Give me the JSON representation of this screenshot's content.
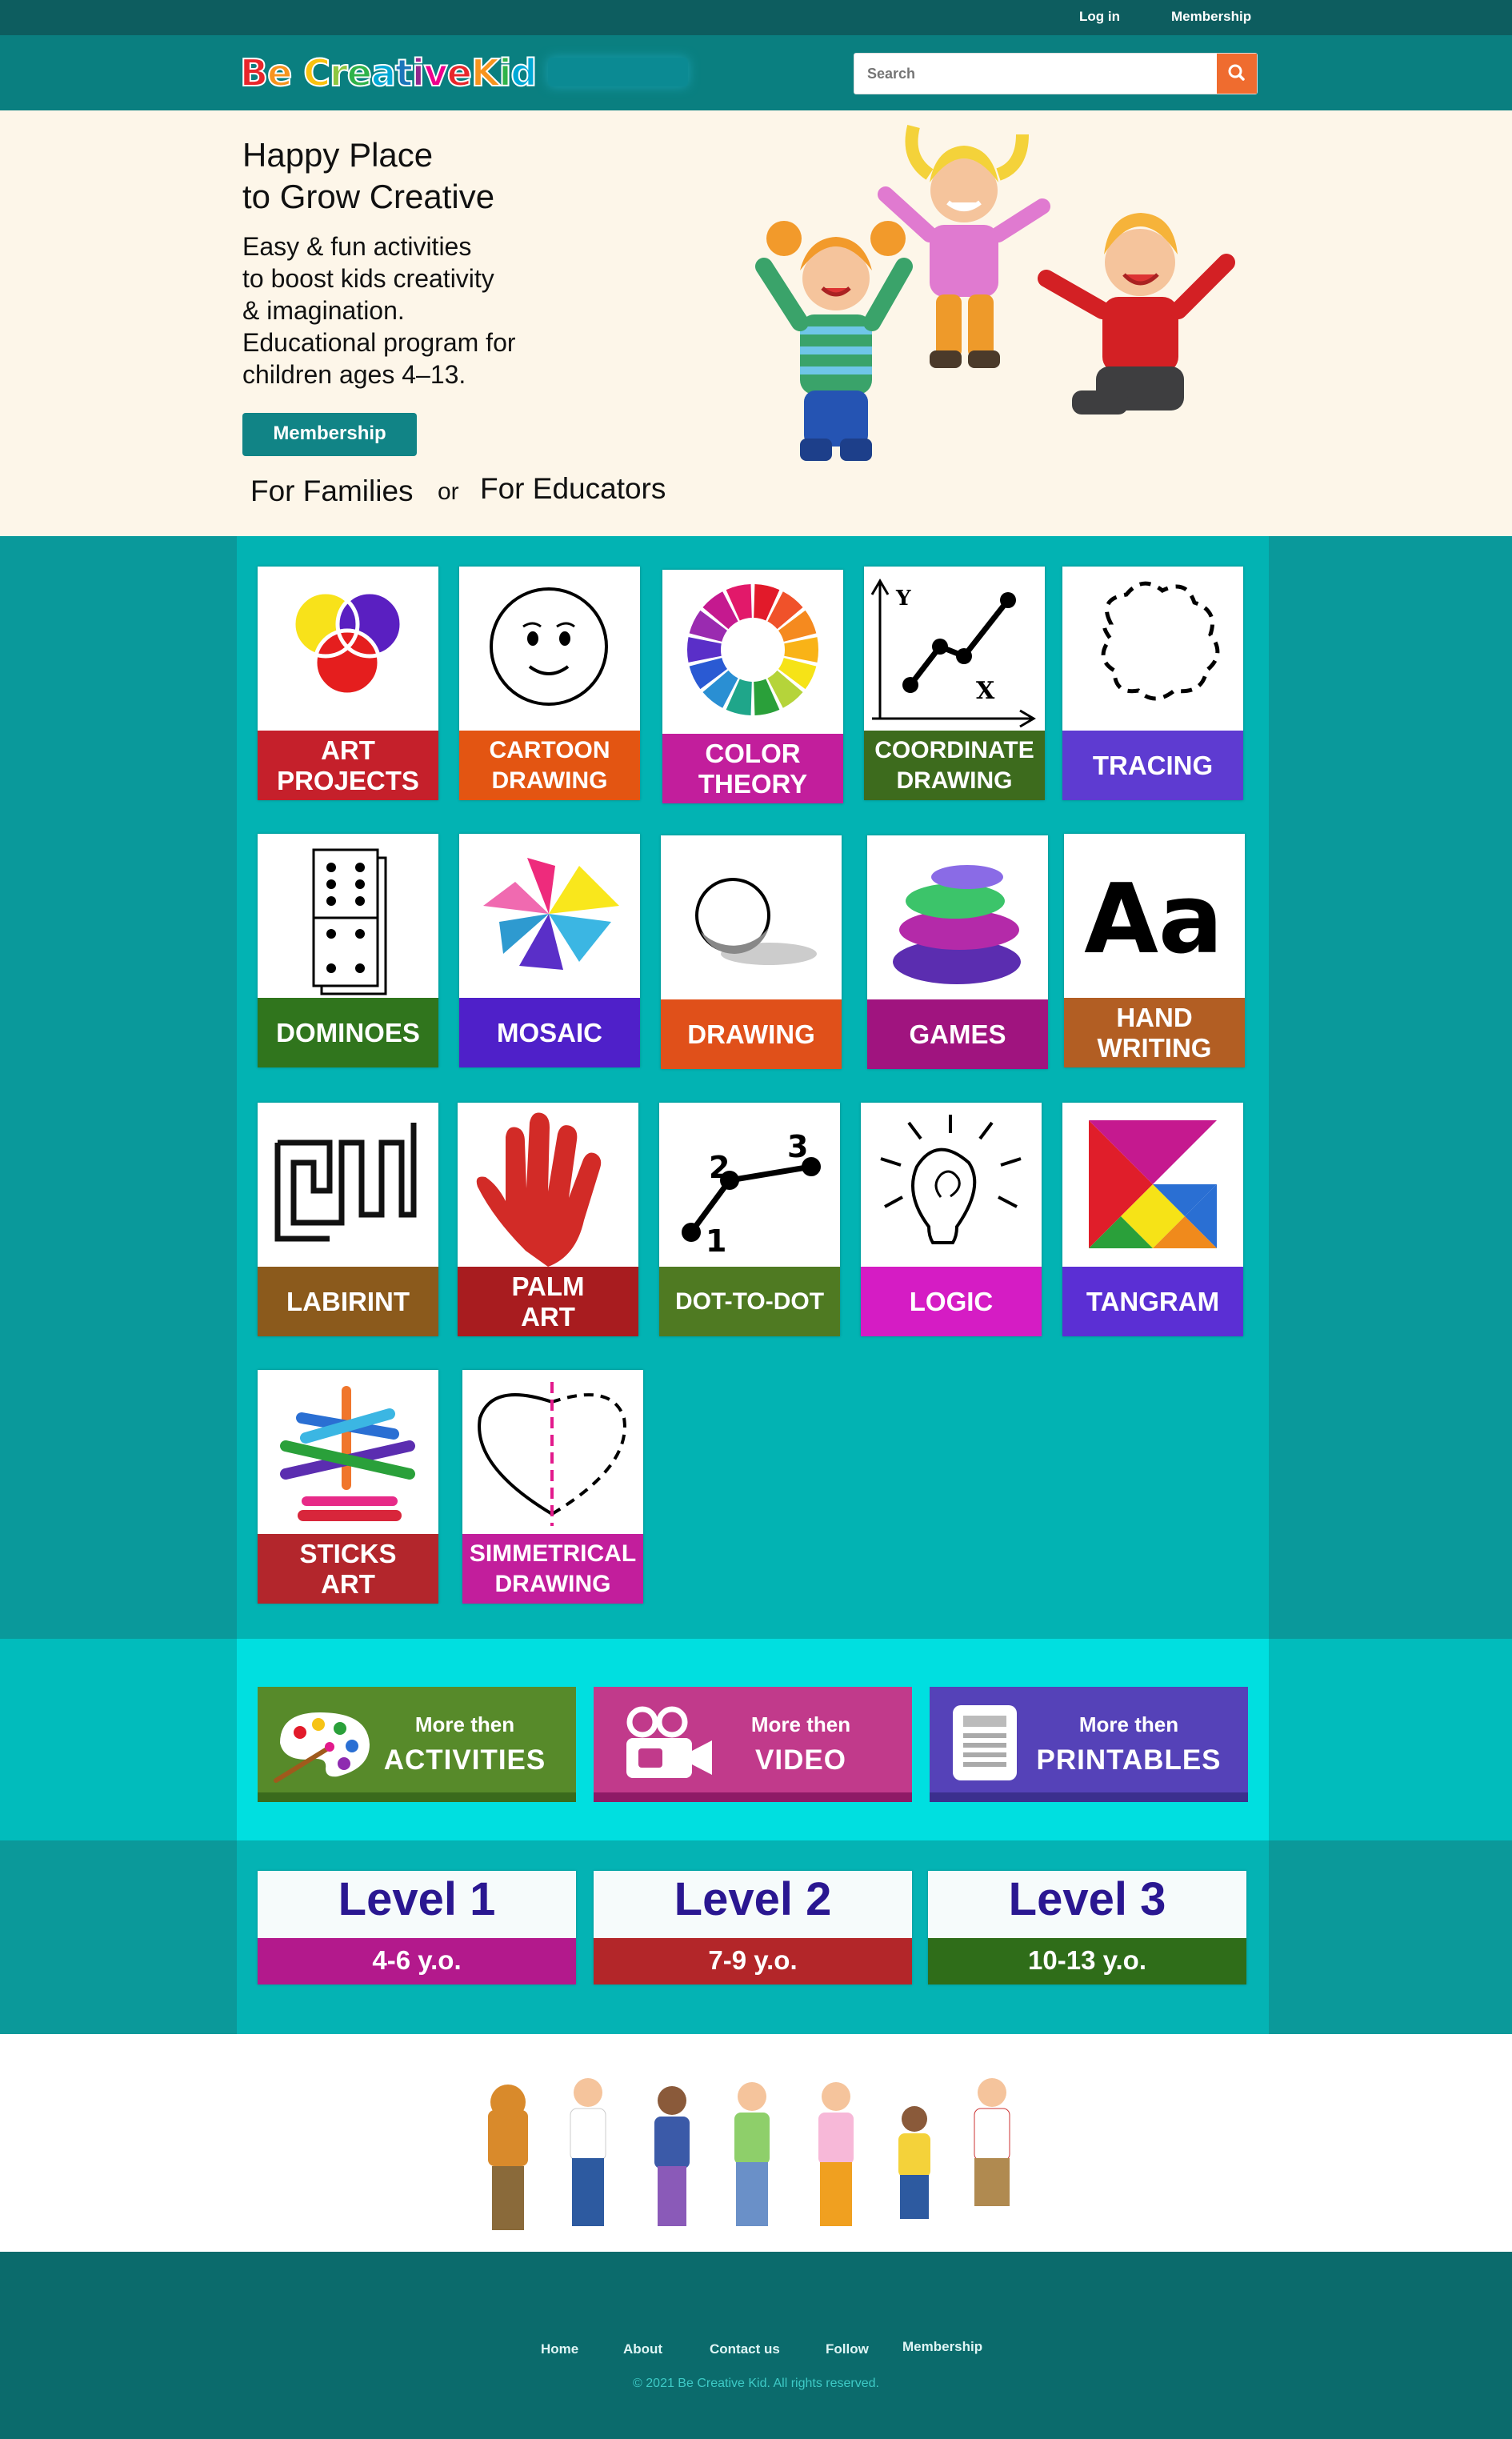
{
  "topbar": {
    "login": "Log in",
    "membership": "Membership"
  },
  "header": {
    "logo_text": "Be Creative Kid",
    "search_placeholder": "Search"
  },
  "hero": {
    "title_line1": "Happy Place",
    "title_line2": "to Grow Creative",
    "desc": [
      "Easy & fun activities",
      "to boost kids creativity",
      "& imagination.",
      "Educational program for",
      "children ages 4–13."
    ],
    "membership_button": "Membership",
    "for_families": "For Families",
    "or": "or",
    "for_educators": "For Educators"
  },
  "categories": [
    {
      "line1": "ART",
      "line2": "PROJECTS",
      "color": "#c5202b",
      "icon": "art-circles-icon"
    },
    {
      "line1": "CARTOON",
      "line2": "DRAWING",
      "color": "#e35512",
      "icon": "smiley-face-icon"
    },
    {
      "line1": "COLOR",
      "line2": "THEORY",
      "color": "#c21e9c",
      "icon": "color-wheel-icon"
    },
    {
      "line1": "COORDINATE",
      "line2": "DRAWING",
      "color": "#3d6b1d",
      "icon": "coordinate-graph-icon"
    },
    {
      "line1": "TRACING",
      "line2": "",
      "color": "#5e3bd1",
      "icon": "dashed-blob-icon"
    },
    {
      "line1": "DOMINOES",
      "line2": "",
      "color": "#30751d",
      "icon": "domino-icon"
    },
    {
      "line1": "MOSAIC",
      "line2": "",
      "color": "#4f20c9",
      "icon": "mosaic-star-icon"
    },
    {
      "line1": "DRAWING",
      "line2": "",
      "color": "#e0501a",
      "icon": "shaded-sphere-icon"
    },
    {
      "line1": "GAMES",
      "line2": "",
      "color": "#a0147f",
      "icon": "stacked-stones-icon"
    },
    {
      "line1": "HAND",
      "line2": "WRITING",
      "color": "#b25e23",
      "icon": "letters-aa-icon"
    },
    {
      "line1": "LABIRINT",
      "line2": "",
      "color": "#8b5a1c",
      "icon": "maze-icon"
    },
    {
      "line1": "PALM",
      "line2": "ART",
      "color": "#a81c1f",
      "icon": "red-hand-icon"
    },
    {
      "line1": "DOT-TO-DOT",
      "line2": "",
      "color": "#4f7a22",
      "icon": "dot-to-dot-icon"
    },
    {
      "line1": "LOGIC",
      "line2": "",
      "color": "#d51cc4",
      "icon": "light-bulb-icon"
    },
    {
      "line1": "TANGRAM",
      "line2": "",
      "color": "#5b2fd4",
      "icon": "tangram-icon"
    },
    {
      "line1": "STICKS",
      "line2": "ART",
      "color": "#b3262c",
      "icon": "sticks-icon"
    },
    {
      "line1": "SIMMETRICAL",
      "line2": "DRAWING",
      "color": "#c21e9c",
      "icon": "half-heart-icon"
    }
  ],
  "more": [
    {
      "small": "More then",
      "big": "ACTIVITIES",
      "color": "#578a2a",
      "bar": "#3a6a1c",
      "icon": "palette-icon"
    },
    {
      "small": "More then",
      "big": "VIDEO",
      "color": "#c13a8b",
      "bar": "#8e1a66",
      "icon": "video-camera-icon"
    },
    {
      "small": "More then",
      "big": "PRINTABLES",
      "color": "#5542b8",
      "bar": "#3b2f8e",
      "icon": "document-icon"
    }
  ],
  "levels": [
    {
      "name": "Level 1",
      "ages": "4-6 y.o.",
      "color": "#b3198c"
    },
    {
      "name": "Level 2",
      "ages": "7-9 y.o.",
      "color": "#b32629"
    },
    {
      "name": "Level 3",
      "ages": "10-13 y.o.",
      "color": "#2f6d19"
    }
  ],
  "footer": {
    "links": [
      "Home",
      "About",
      "Contact us",
      "Follow",
      "Membership"
    ],
    "copyright": "© 2021 Be Creative Kid. All rights reserved."
  }
}
